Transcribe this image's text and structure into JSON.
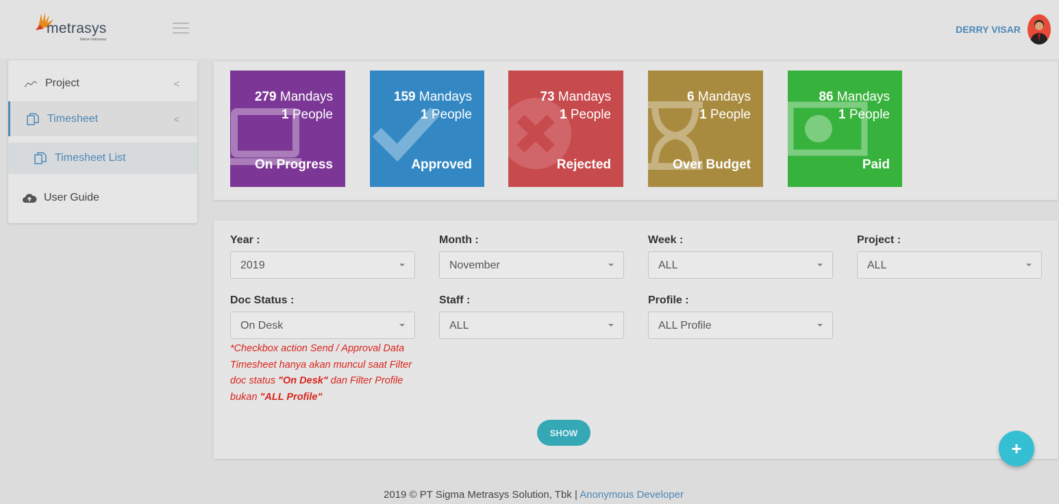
{
  "header": {
    "logo_text": "metrasys",
    "logo_tagline": "Telkom Indonesia",
    "user_name": "DERRY VISAR"
  },
  "sidebar": {
    "items": [
      {
        "label": "Project",
        "icon": "line-chart-icon",
        "chevron": "<"
      },
      {
        "label": "Timesheet",
        "icon": "copy-icon",
        "chevron": "<",
        "active": true
      },
      {
        "label": "Timesheet List",
        "icon": "copy-icon"
      },
      {
        "label": "User Guide",
        "icon": "cloud-upload-icon"
      }
    ]
  },
  "cards": [
    {
      "mandays": "279",
      "mandays_unit": "Mandays",
      "people": "1",
      "people_unit": "People",
      "label": "On Progress",
      "color": "#7c3796",
      "icon": "laptop-icon"
    },
    {
      "mandays": "159",
      "mandays_unit": "Mandays",
      "people": "1",
      "people_unit": "People",
      "label": "Approved",
      "color": "#3388c3",
      "icon": "check-icon"
    },
    {
      "mandays": "73",
      "mandays_unit": "Mandays",
      "people": "1",
      "people_unit": "People",
      "label": "Rejected",
      "color": "#c74a4d",
      "icon": "times-circle-icon"
    },
    {
      "mandays": "6",
      "mandays_unit": "Mandays",
      "people": "1",
      "people_unit": "People",
      "label": "Over Budget",
      "color": "#a98b3f",
      "icon": "hourglass-icon"
    },
    {
      "mandays": "86",
      "mandays_unit": "Mandays",
      "people": "1",
      "people_unit": "People",
      "label": "Paid",
      "color": "#37b23c",
      "icon": "money-icon"
    }
  ],
  "filters": {
    "year": {
      "label": "Year :",
      "value": "2019"
    },
    "month": {
      "label": "Month :",
      "value": "November"
    },
    "week": {
      "label": "Week :",
      "value": "ALL"
    },
    "project": {
      "label": "Project :",
      "value": "ALL"
    },
    "doc_status": {
      "label": "Doc Status :",
      "value": "On Desk"
    },
    "staff": {
      "label": "Staff :",
      "value": "ALL"
    },
    "profile": {
      "label": "Profile :",
      "value": "ALL Profile"
    }
  },
  "note": {
    "part1": "*Checkbox action Send / Approval Data Timesheet hanya akan muncul saat Filter doc status ",
    "bold1": "\"On Desk\"",
    "part2": " dan Filter Profile bukan ",
    "bold2": "\"ALL Profile\""
  },
  "show_button": "SHOW",
  "fab": "+",
  "footer": {
    "text": "2019 © PT Sigma Metrasys Solution, Tbk | ",
    "link": "Anonymous Developer"
  }
}
